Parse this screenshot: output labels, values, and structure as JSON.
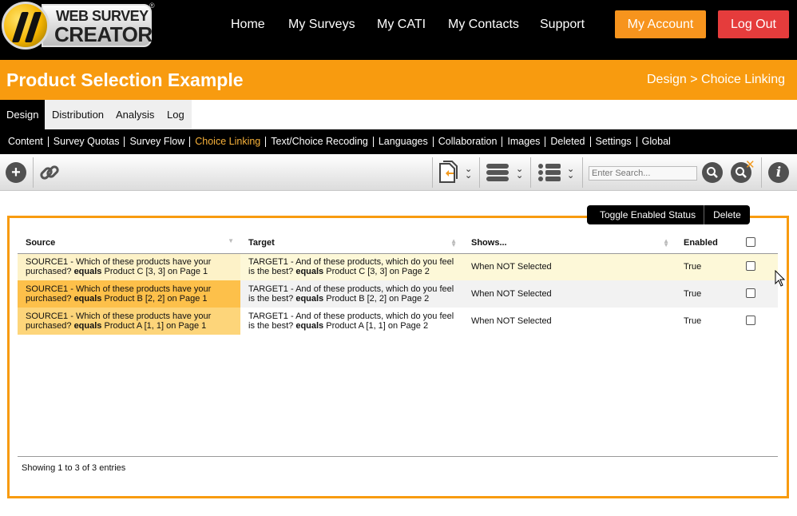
{
  "logo": {
    "line1": "WEB SURVEY",
    "line2": "CREATOR",
    "reg": "®"
  },
  "nav": {
    "items": [
      "Home",
      "My Surveys",
      "My CATI",
      "My Contacts",
      "Support"
    ],
    "account": "My Account",
    "logout": "Log Out"
  },
  "header": {
    "title": "Product Selection Example",
    "breadcrumb": "Design > Choice Linking"
  },
  "main_tabs": [
    "Design",
    "Distribution",
    "Analysis",
    "Log"
  ],
  "sub_tabs": [
    "Content",
    "Survey Quotas",
    "Survey Flow",
    "Choice Linking",
    "Text/Choice Recoding",
    "Languages",
    "Collaboration",
    "Images",
    "Deleted",
    "Settings",
    "Global"
  ],
  "toolbar": {
    "search_placeholder": "Enter Search...",
    "icons": [
      "plus-icon",
      "link-icon",
      "page-export-icon",
      "database-icon",
      "list-icon",
      "search-icon",
      "clear-search-icon",
      "info-icon"
    ]
  },
  "actions": {
    "toggle": "Toggle Enabled Status",
    "delete": "Delete"
  },
  "table": {
    "columns": [
      "Source",
      "Target",
      "Shows...",
      "Enabled"
    ],
    "rows": [
      {
        "src_a": "SOURCE1 - Which of these products have your purchased?",
        "src_op": "equals",
        "src_b": "Product C [3, 3] on Page 1",
        "tgt_a": "TARGET1 - And of these products, which do you feel is the best?",
        "tgt_op": "equals",
        "tgt_b": "Product C [3, 3] on Page 2",
        "shows": "When NOT Selected",
        "enabled": "True"
      },
      {
        "src_a": "SOURCE1 - Which of these products have your purchased?",
        "src_op": "equals",
        "src_b": "Product B [2, 2] on Page 1",
        "tgt_a": "TARGET1 - And of these products, which do you feel is the best?",
        "tgt_op": "equals",
        "tgt_b": "Product B [2, 2] on Page 2",
        "shows": "When NOT Selected",
        "enabled": "True"
      },
      {
        "src_a": "SOURCE1 - Which of these products have your purchased?",
        "src_op": "equals",
        "src_b": "Product A [1, 1] on Page 1",
        "tgt_a": "TARGET1 - And of these products, which do you feel is the best?",
        "tgt_op": "equals",
        "tgt_b": "Product A [1, 1] on Page 2",
        "shows": "When NOT Selected",
        "enabled": "True"
      }
    ],
    "footer": "Showing 1 to 3 of 3 entries"
  },
  "colors": {
    "orange": "#f89b0f",
    "account": "#f7941d",
    "logout": "#e53c3c",
    "active_subtab": "#f7b13a"
  }
}
